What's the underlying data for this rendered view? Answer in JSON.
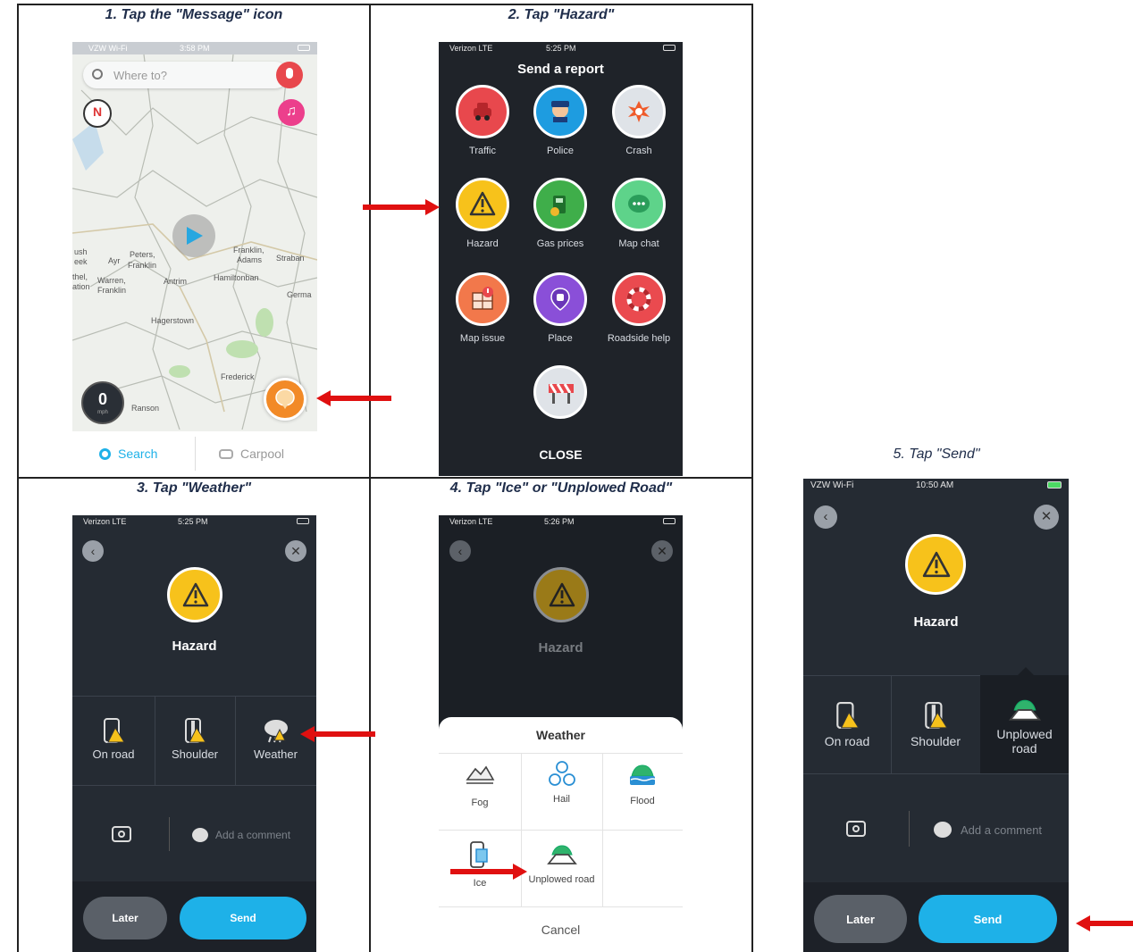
{
  "captions": {
    "step1": "1. Tap the \"Message\" icon",
    "step2": "2. Tap \"Hazard\"",
    "step3": "3. Tap \"Weather\"",
    "step4": "4. Tap \"Ice\" or \"Unplowed Road\"",
    "step5": "5. Tap \"Send\""
  },
  "step1": {
    "status": {
      "carrier": "VZW Wi-Fi",
      "time": "3:58 PM"
    },
    "search_placeholder": "Where to?",
    "map_labels": [
      "ush",
      "eek",
      "Ayr",
      "Peters,",
      "Franklin",
      "thel,",
      "ation",
      "Warren,",
      "Franklin",
      "Antrim",
      "Franklin,",
      "Adams",
      "Straban",
      "Hamiltonban",
      "Germa",
      "Hagerstown",
      "Frederick",
      "Ranson"
    ],
    "speed_value": "0",
    "speed_unit": "mph",
    "bottom_tabs": {
      "search": "Search",
      "carpool": "Carpool"
    }
  },
  "step2": {
    "status": {
      "carrier": "Verizon LTE",
      "time": "5:25 PM"
    },
    "title": "Send a report",
    "items": [
      {
        "label": "Traffic",
        "color": "#e8484d",
        "icon": "traffic-icon"
      },
      {
        "label": "Police",
        "color": "#1e9ce0",
        "icon": "police-icon"
      },
      {
        "label": "Crash",
        "color": "#dfe3e8",
        "icon": "crash-icon"
      },
      {
        "label": "Hazard",
        "color": "#f7c21b",
        "icon": "hazard-icon"
      },
      {
        "label": "Gas prices",
        "color": "#3fae4a",
        "icon": "gas-icon"
      },
      {
        "label": "Map chat",
        "color": "#5ed38a",
        "icon": "chat-icon"
      },
      {
        "label": "Map issue",
        "color": "#f2784b",
        "icon": "map-issue-icon"
      },
      {
        "label": "Place",
        "color": "#8a4fd8",
        "icon": "place-icon"
      },
      {
        "label": "Roadside help",
        "color": "#ea4a4f",
        "icon": "roadside-icon"
      }
    ],
    "close_label": "CLOSE"
  },
  "step3": {
    "status": {
      "carrier": "Verizon LTE",
      "time": "5:25 PM"
    },
    "title": "Hazard",
    "options": [
      "On road",
      "Shoulder",
      "Weather"
    ],
    "comment_placeholder": "Add a comment",
    "later_label": "Later",
    "send_label": "Send"
  },
  "step4": {
    "status": {
      "carrier": "Verizon LTE",
      "time": "5:26 PM"
    },
    "title": "Hazard",
    "sheet_title": "Weather",
    "options": [
      "Fog",
      "Hail",
      "Flood",
      "Ice",
      "Unplowed road"
    ],
    "cancel_label": "Cancel"
  },
  "step5": {
    "status": {
      "carrier": "VZW Wi-Fi",
      "time": "10:50 AM"
    },
    "title": "Hazard",
    "options": [
      "On road",
      "Shoulder",
      "Unplowed\nroad"
    ],
    "comment_placeholder": "Add a comment",
    "later_label": "Later",
    "send_label": "Send"
  },
  "colors": {
    "accent_blue": "#1eb1e8",
    "arrow_red": "#e01010",
    "hazard_yellow": "#f7c21b",
    "dark_bg": "#252b33"
  }
}
